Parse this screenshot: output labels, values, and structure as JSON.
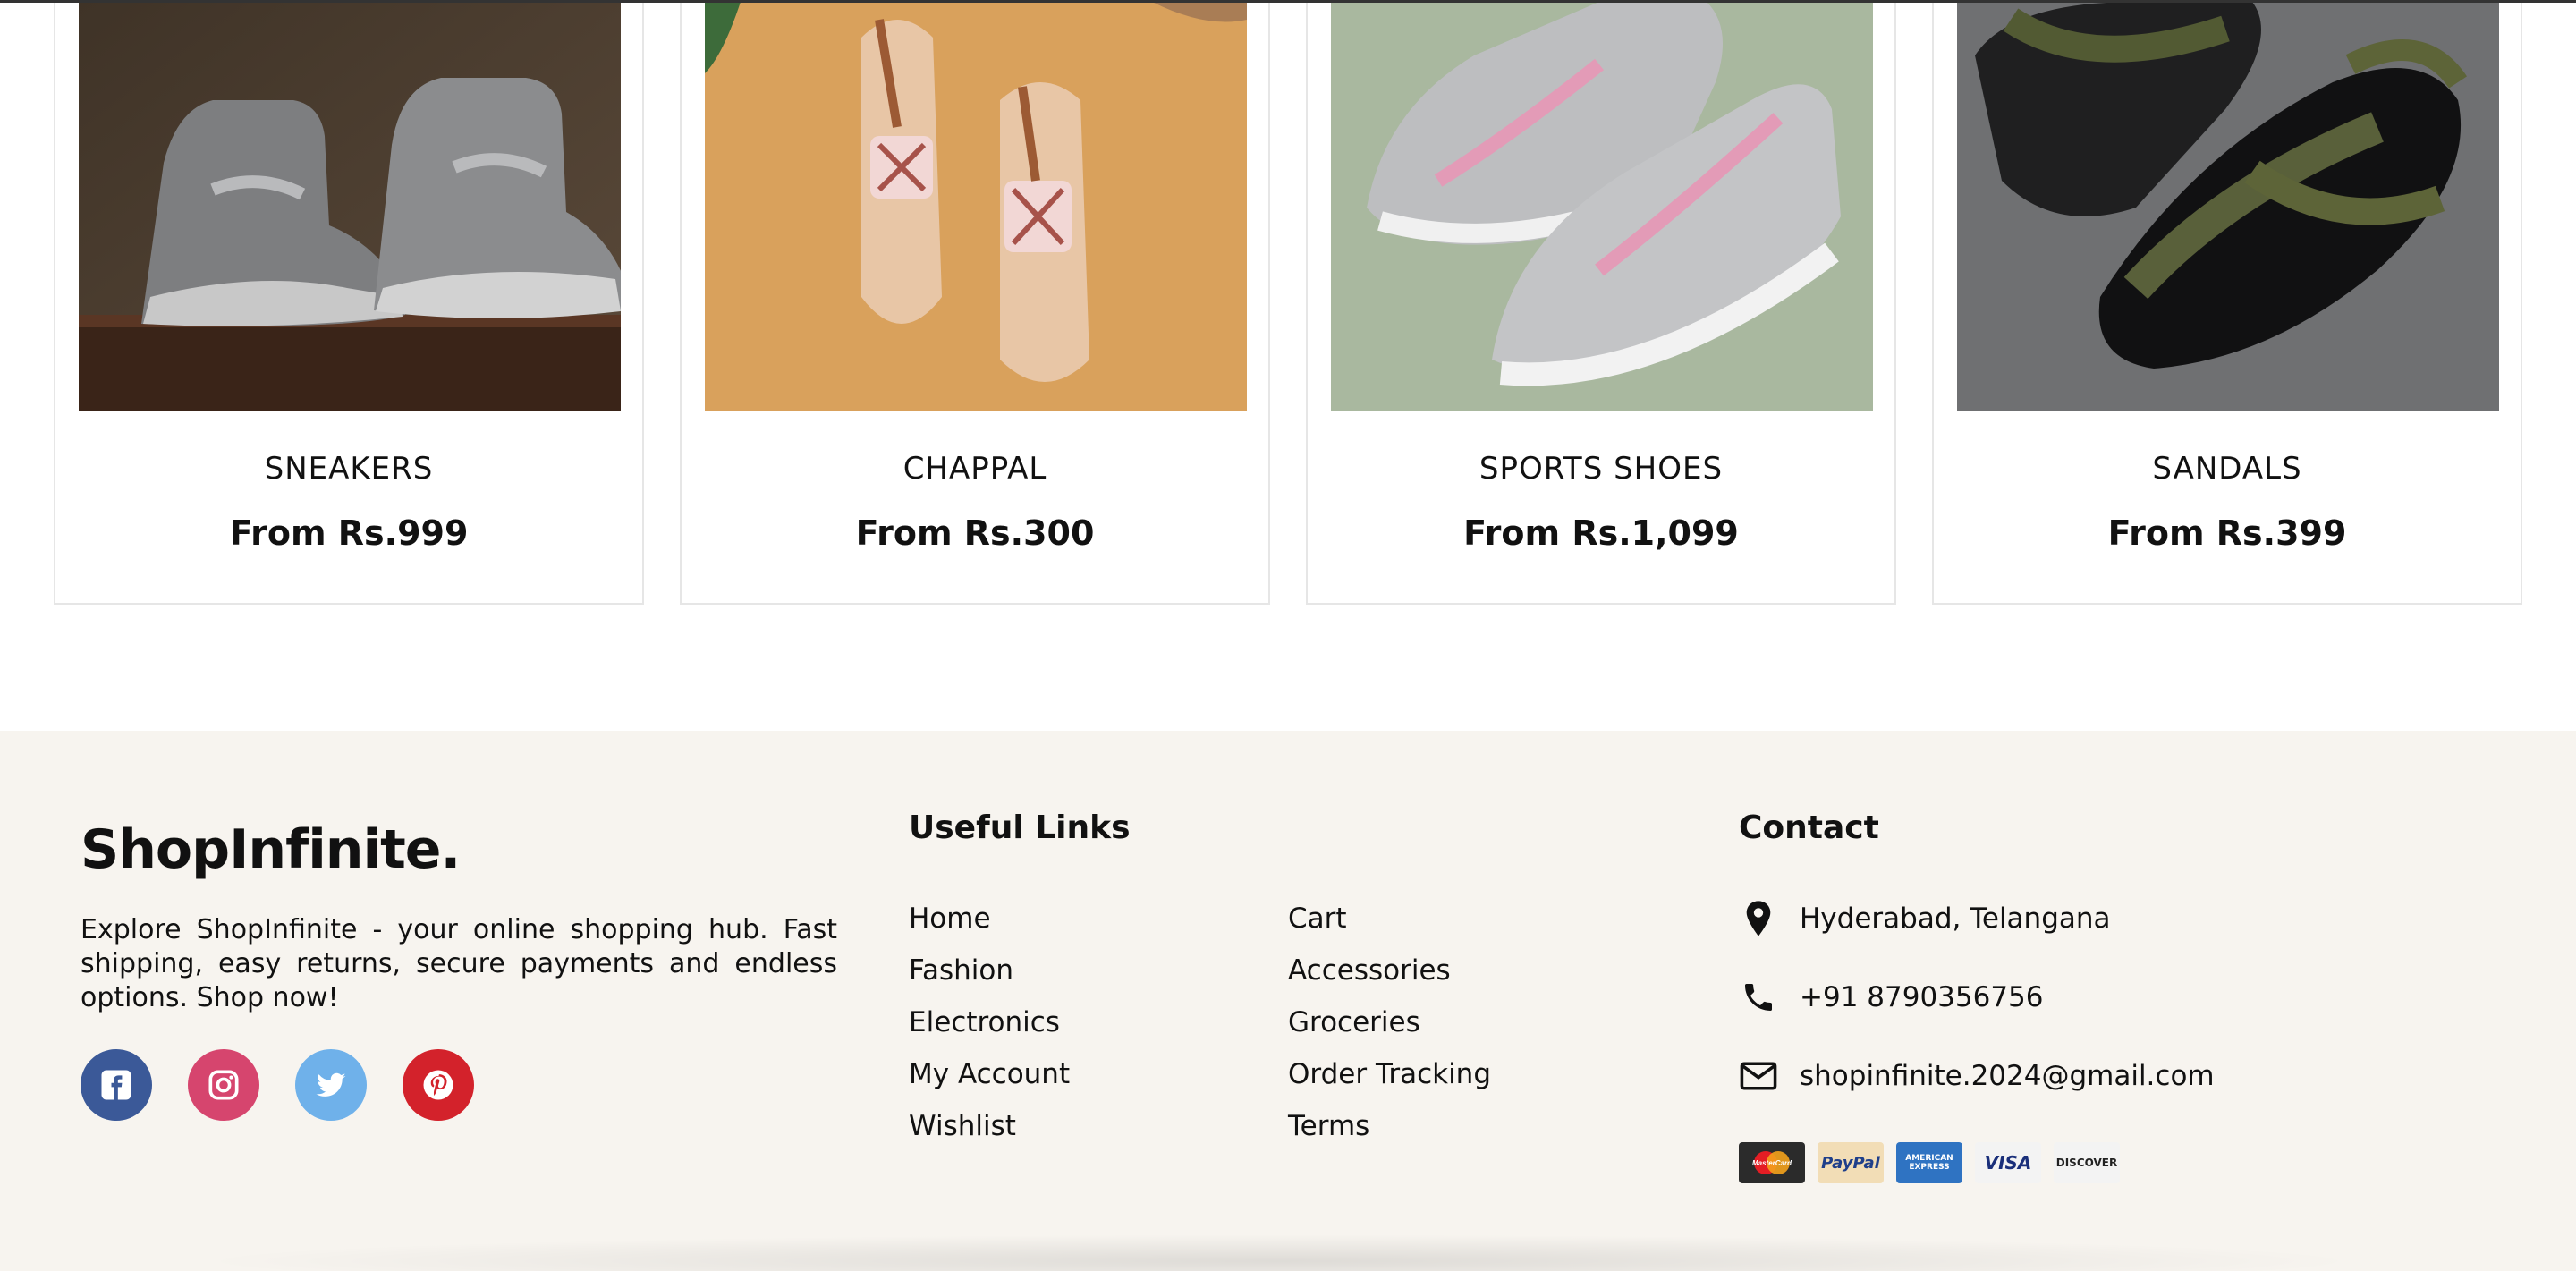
{
  "products": [
    {
      "name": "SNEAKERS",
      "price": "From Rs.999"
    },
    {
      "name": "CHAPPAL",
      "price": "From Rs.300"
    },
    {
      "name": "SPORTS SHOES",
      "price": "From Rs.1,099"
    },
    {
      "name": "SANDALS",
      "price": "From Rs.399"
    }
  ],
  "footer": {
    "brand": "ShopInfinite.",
    "about": "Explore ShopInfinite - your online shopping hub. Fast shipping, easy returns, secure payments and endless options. Shop now!",
    "socials": [
      "facebook-icon",
      "instagram-icon",
      "twitter-icon",
      "pinterest-icon"
    ],
    "useful_links_title": "Useful Links",
    "links_col1": [
      "Home",
      "Fashion",
      "Electronics",
      "My Account",
      "Wishlist"
    ],
    "links_col2": [
      "Cart",
      "Accessories",
      "Groceries",
      "Order Tracking",
      "Terms"
    ],
    "contact_title": "Contact",
    "address": "Hyderabad, Telangana",
    "phone": "+91 8790356756",
    "email": "shopinfinite.2024@gmail.com",
    "payments": [
      "MasterCard",
      "PayPal",
      "AMERICAN EXPRESS",
      "VISA",
      "DISCOVER"
    ]
  },
  "colors": {
    "footer_bg": "#f7f4ef",
    "facebook": "#3b5998",
    "instagram": "#d6456e",
    "twitter": "#6fb1ea",
    "pinterest": "#d3222b"
  }
}
